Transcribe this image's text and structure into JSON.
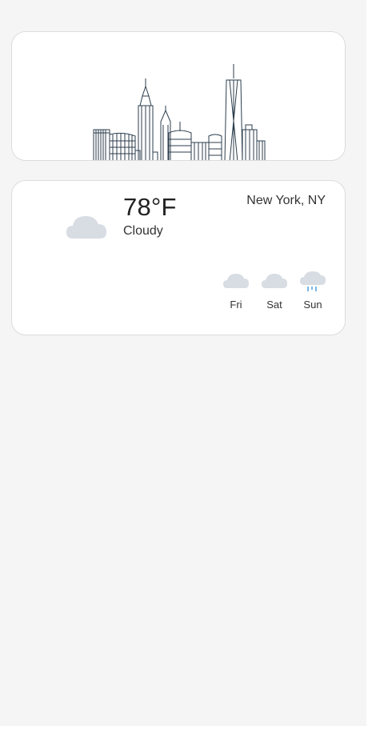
{
  "skyline_card": {
    "image_icon": "new-york-skyline-illustration"
  },
  "weather": {
    "current": {
      "temperature": "78°F",
      "condition": "Cloudy",
      "icon": "cloud-icon"
    },
    "location": "New York, NY",
    "forecast": [
      {
        "day": "Fri",
        "icon": "cloud-icon"
      },
      {
        "day": "Sat",
        "icon": "cloud-icon"
      },
      {
        "day": "Sun",
        "icon": "rain-cloud-icon"
      }
    ]
  },
  "colors": {
    "background": "#f5f5f5",
    "card": "#ffffff",
    "cloud": "#d8dce3",
    "rain": "#4a9fe0",
    "skyline_stroke": "#2c3e4c"
  }
}
